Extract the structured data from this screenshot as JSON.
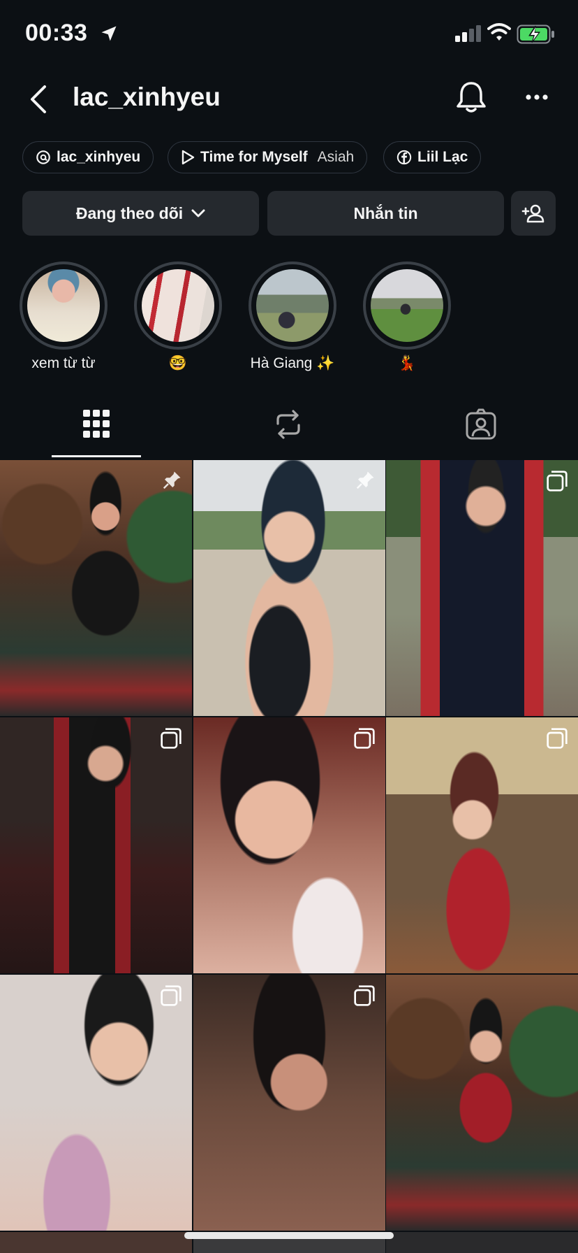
{
  "status": {
    "time": "00:33"
  },
  "header": {
    "username": "lac_xinhyeu"
  },
  "links": [
    {
      "label": "lac_xinhyeu",
      "icon": "threads-icon"
    },
    {
      "label": "Time for Myself",
      "sub": "Asiah",
      "icon": "play-icon"
    },
    {
      "label": "Liil Lạc",
      "icon": "facebook-icon"
    }
  ],
  "actions": {
    "following": "Đang theo dõi",
    "message": "Nhắn tin"
  },
  "highlights": [
    {
      "label": "xem từ từ"
    },
    {
      "label": "🤓"
    },
    {
      "label": "Hà Giang ✨"
    },
    {
      "label": "💃"
    }
  ],
  "grid": {
    "posts": [
      {
        "badge": "pin-icon"
      },
      {
        "badge": "pin-icon"
      },
      {
        "badge": "carousel-icon"
      },
      {
        "badge": "carousel-icon"
      },
      {
        "badge": "carousel-icon"
      },
      {
        "badge": "carousel-icon"
      },
      {
        "badge": "carousel-icon"
      },
      {
        "badge": "carousel-icon"
      },
      {
        "badge": "none"
      }
    ]
  },
  "colors": {
    "background": "#0c1014",
    "button": "#25292e",
    "battery": "#4cd964"
  }
}
